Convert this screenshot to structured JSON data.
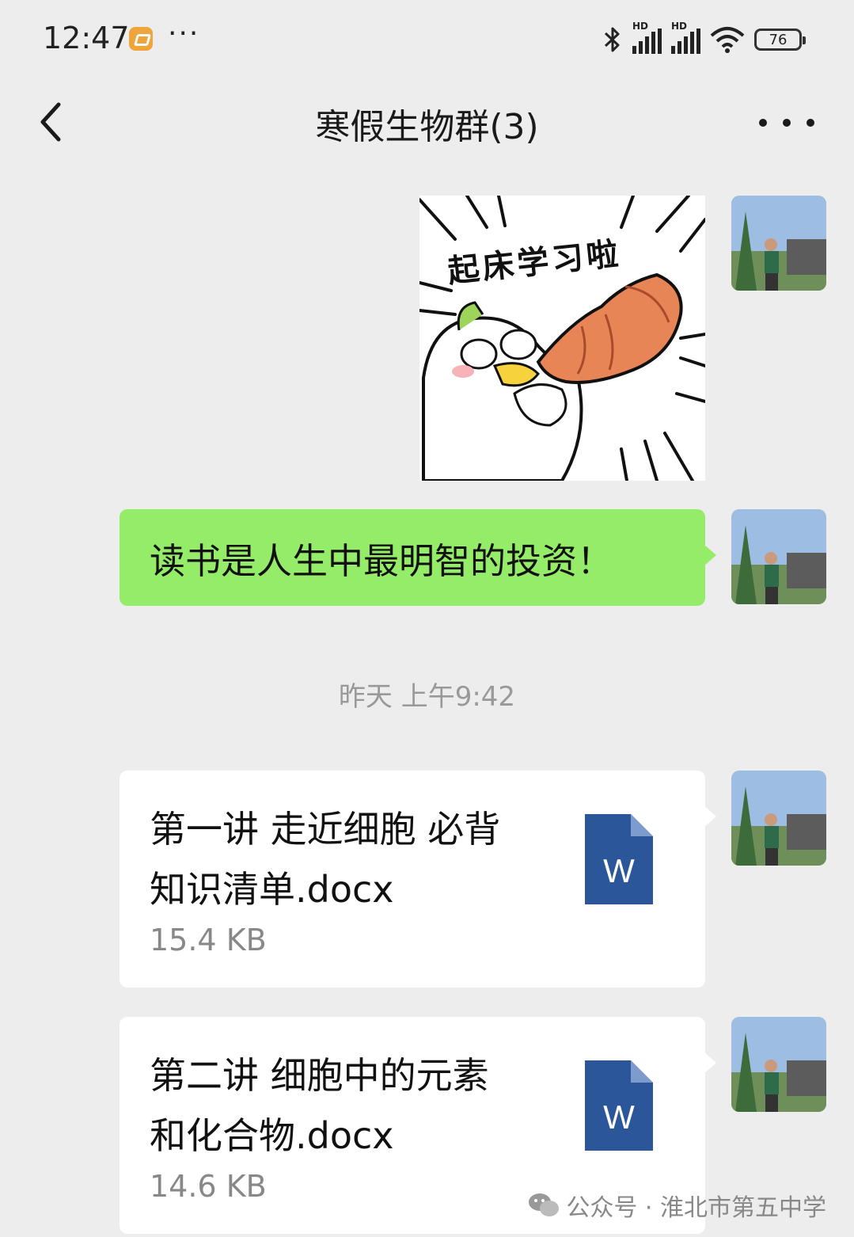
{
  "status_bar": {
    "time": "12:47",
    "more": "···",
    "hd1": "HD",
    "hd2": "HD",
    "battery": "76"
  },
  "nav": {
    "title": "寒假生物群(3)"
  },
  "messages": {
    "sticker_caption": "起床学习啦",
    "text_message": "读书是人生中最明智的投资！",
    "timestamp": "昨天 上午9:42",
    "files": [
      {
        "line1": "第一讲 走近细胞 必背",
        "line2": "知识清单.docx",
        "size": "15.4 KB",
        "icon_letter": "W"
      },
      {
        "line1": "第二讲 细胞中的元素",
        "line2": "和化合物.docx",
        "size": "14.6 KB",
        "icon_letter": "W"
      }
    ]
  },
  "watermark": {
    "text": "公众号 · 淮北市第五中学"
  },
  "colors": {
    "background": "#ededed",
    "bubble_green": "#95ec69",
    "word_blue": "#2b579a",
    "timestamp_gray": "#999999"
  }
}
